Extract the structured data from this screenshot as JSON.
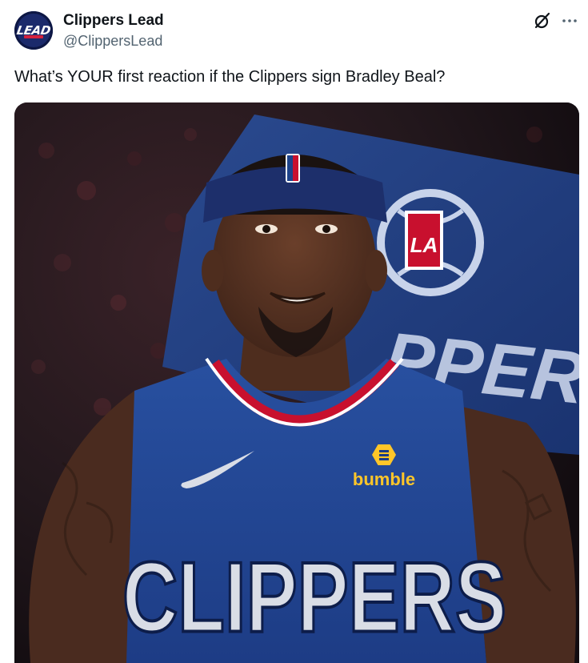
{
  "author": {
    "display_name": "Clippers Lead",
    "handle": "@ClippersLead",
    "avatar_text": "LEAD"
  },
  "tweet": {
    "text": "What’s YOUR first reaction if the Clippers sign Bradley Beal?"
  },
  "media": {
    "jersey_wordmark": "CLIPPERS",
    "sponsor_text": "bumble",
    "flag_text": "PPERS",
    "flag_logo_text": "LA"
  },
  "icons": {
    "grok": "grok-icon",
    "more": "more-dots-icon"
  },
  "colors": {
    "clippers_blue": "#1d428a",
    "clippers_red": "#c8102e",
    "sponsor_yellow": "#ffc629",
    "handle_gray": "#536471"
  }
}
